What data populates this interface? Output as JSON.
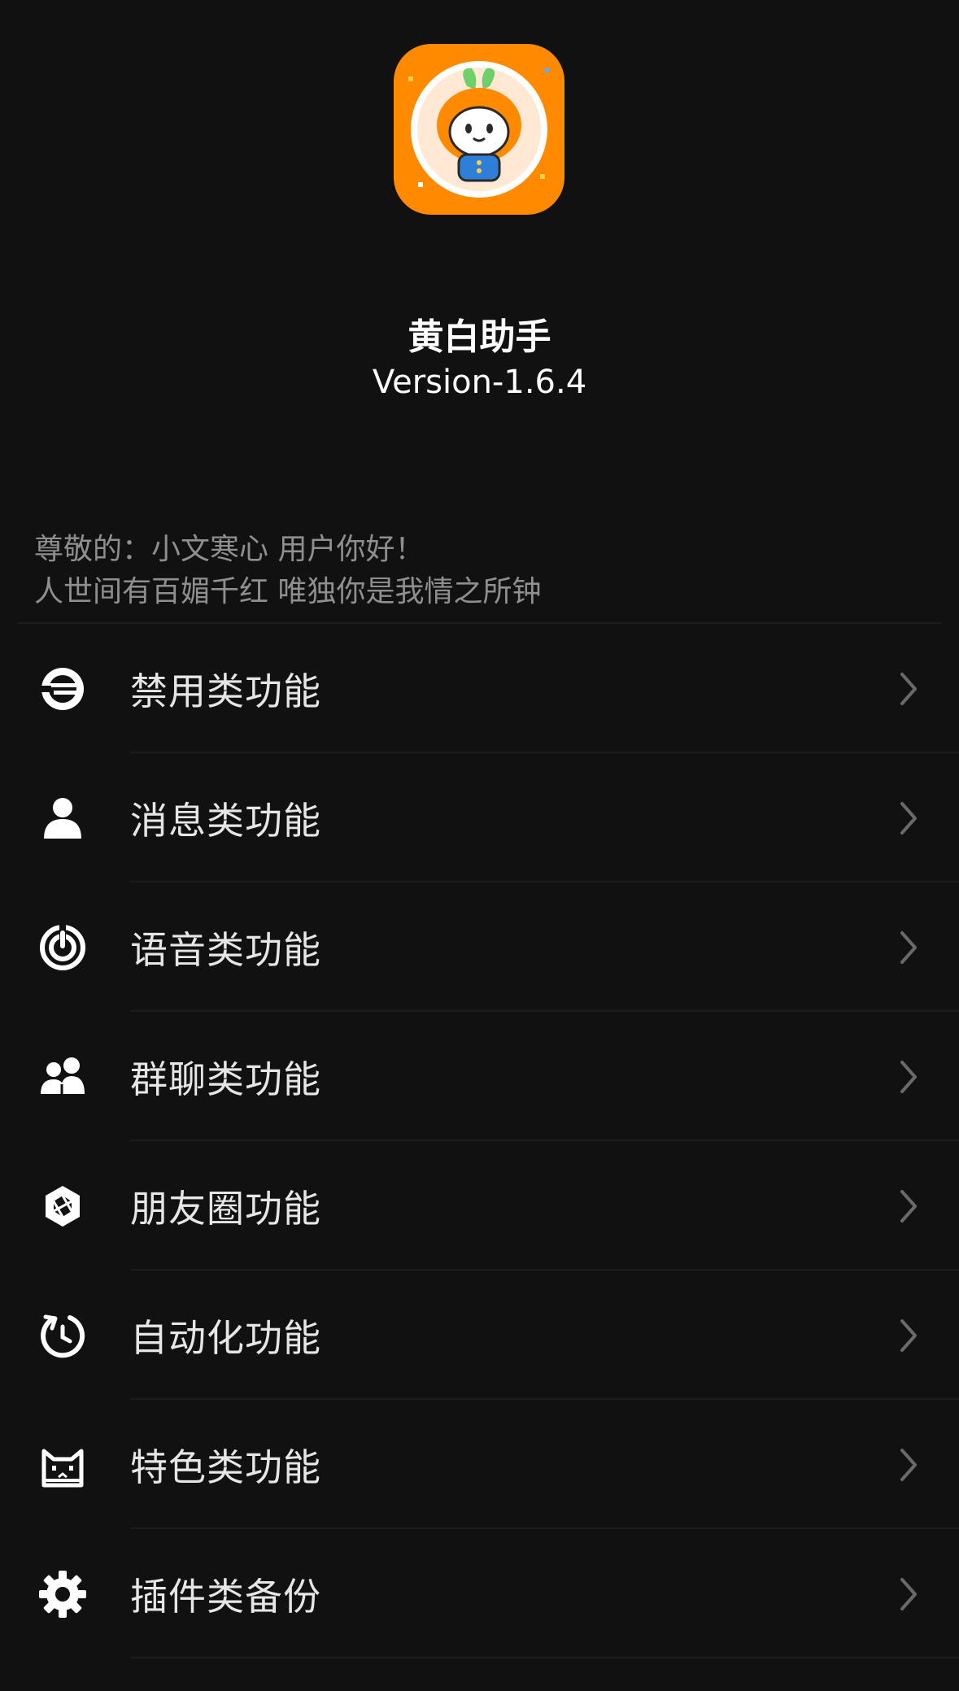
{
  "app": {
    "name": "黄白助手",
    "version": "Version-1.6.4"
  },
  "greeting": {
    "line1": "尊敬的：小文寒心 用户你好！",
    "line2": "人世间有百媚千红 唯独你是我情之所钟"
  },
  "colors": {
    "background": "#111111",
    "icon_orange": "#ff8a00",
    "text": "#e6e6e6",
    "subtext": "#8f8f8f",
    "chevron": "#6a6a6a"
  },
  "menu": {
    "items": [
      {
        "label": "禁用类功能",
        "icon": "block-icon"
      },
      {
        "label": "消息类功能",
        "icon": "user-icon"
      },
      {
        "label": "语音类功能",
        "icon": "voice-icon"
      },
      {
        "label": "群聊类功能",
        "icon": "group-icon"
      },
      {
        "label": "朋友圈功能",
        "icon": "moments-icon"
      },
      {
        "label": "自动化功能",
        "icon": "timer-icon"
      },
      {
        "label": "特色类功能",
        "icon": "cat-icon"
      },
      {
        "label": "插件类备份",
        "icon": "gear-icon"
      }
    ]
  }
}
